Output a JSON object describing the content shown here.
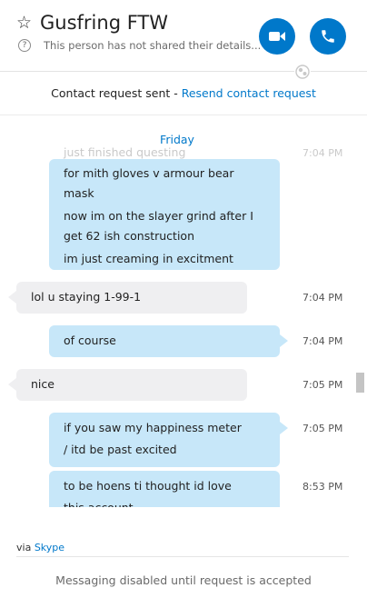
{
  "header": {
    "title": "Gusfring FTW",
    "subtitle": "This person has not shared their details...",
    "colors": {
      "accent": "#0078ca"
    }
  },
  "request": {
    "text": "Contact request sent - ",
    "link": "Resend contact request"
  },
  "conversation": {
    "date_label": "Friday",
    "partial_top_text": "just finished questing",
    "partial_top_time": "7:04 PM",
    "messages": [
      {
        "direction": "out",
        "lines": [
          "for mith gloves v armour bear mask",
          "now im on the slayer grind after I get 62 ish construction",
          "im just creaming in excitment"
        ],
        "time": ""
      },
      {
        "direction": "in",
        "lines": [
          "lol u staying 1-99-1"
        ],
        "time": "7:04 PM"
      },
      {
        "direction": "out",
        "lines": [
          "of course"
        ],
        "time": "7:04 PM"
      },
      {
        "direction": "in",
        "lines": [
          "nice"
        ],
        "time": "7:05 PM"
      },
      {
        "direction": "out",
        "lines": [
          "if you saw my happiness meter",
          "/ itd be past excited"
        ],
        "time": "7:05 PM"
      },
      {
        "direction": "out",
        "lines": [
          "to be hoens ti thought id love this account"
        ],
        "time": "8:53 PM"
      }
    ]
  },
  "footer": {
    "via_prefix": "via",
    "via_brand": "Skype",
    "status": "Messaging disabled until request is accepted"
  },
  "icons": [
    "star-icon",
    "question-icon",
    "video-camera-icon",
    "phone-icon",
    "presence-globe-icon"
  ]
}
